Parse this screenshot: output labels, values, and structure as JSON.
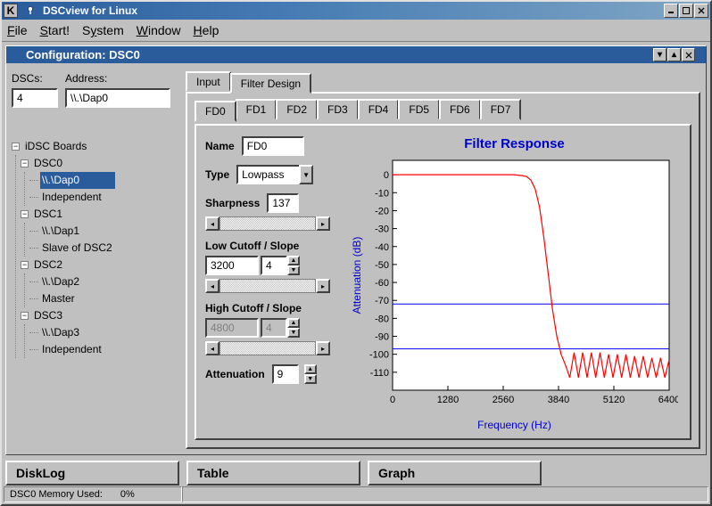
{
  "window": {
    "app_icon": "K",
    "title": "DSCview for Linux"
  },
  "menubar": [
    "File",
    "Start!",
    "System",
    "Window",
    "Help"
  ],
  "sub_window": {
    "title": "Configuration: DSC0"
  },
  "left": {
    "dscs_label": "DSCs:",
    "address_label": "Address:",
    "dscs_value": "4",
    "address_value": "\\\\.\\Dap0",
    "tree_root": "iDSC Boards",
    "tree": [
      {
        "board": "DSC0",
        "children": [
          "\\\\.\\Dap0",
          "Independent"
        ],
        "sel": 0
      },
      {
        "board": "DSC1",
        "children": [
          "\\\\.\\Dap1",
          "Slave of DSC2"
        ]
      },
      {
        "board": "DSC2",
        "children": [
          "\\\\.\\Dap2",
          "Master"
        ]
      },
      {
        "board": "DSC3",
        "children": [
          "\\\\.\\Dap3",
          "Independent"
        ]
      }
    ]
  },
  "tabs": {
    "input": "Input",
    "filter_design": "Filter Design"
  },
  "fd_tabs": [
    "FD0",
    "FD1",
    "FD2",
    "FD3",
    "FD4",
    "FD5",
    "FD6",
    "FD7"
  ],
  "params": {
    "name_label": "Name",
    "name_value": "FD0",
    "type_label": "Type",
    "type_value": "Lowpass",
    "sharpness_label": "Sharpness",
    "sharpness_value": "137",
    "low_label": "Low Cutoff / Slope",
    "low_cutoff": "3200",
    "low_slope": "4",
    "high_label": "High Cutoff / Slope",
    "high_cutoff": "4800",
    "high_slope": "4",
    "atten_label": "Attenuation",
    "atten_value": "9"
  },
  "chart": {
    "title": "Filter Response",
    "xlabel": "Frequency (Hz)",
    "ylabel": "Attenuation (dB)"
  },
  "chart_data": {
    "type": "line",
    "title": "Filter Response",
    "xlabel": "Frequency (Hz)",
    "ylabel": "Attenuation (dB)",
    "xlim": [
      0,
      6400
    ],
    "ylim": [
      -120,
      8
    ],
    "xticks": [
      0,
      1280,
      2560,
      3840,
      5120,
      6400
    ],
    "yticks": [
      0,
      -10,
      -20,
      -30,
      -40,
      -50,
      -60,
      -70,
      -80,
      -90,
      -100,
      -110
    ],
    "hlines": [
      -72,
      -97
    ],
    "series": [
      {
        "name": "response",
        "color": "#ff0000",
        "x": [
          0,
          400,
          800,
          1200,
          1600,
          2000,
          2400,
          2800,
          3000,
          3100,
          3200,
          3300,
          3400,
          3500,
          3600,
          3700,
          3800,
          3900,
          4000,
          4100,
          4200,
          4300,
          4400,
          4500,
          4600,
          4700,
          4800,
          4900,
          5000,
          5100,
          5200,
          5300,
          5400,
          5500,
          5600,
          5700,
          5800,
          5900,
          6000,
          6100,
          6200,
          6300,
          6400
        ],
        "y": [
          0,
          0,
          0,
          0,
          0,
          0,
          0,
          0,
          -0.5,
          -1,
          -3,
          -8,
          -18,
          -35,
          -55,
          -75,
          -90,
          -100,
          -106,
          -113,
          -99,
          -113,
          -99,
          -113,
          -99,
          -113,
          -99,
          -113,
          -100,
          -113,
          -100,
          -113,
          -100,
          -113,
          -101,
          -113,
          -101,
          -113,
          -102,
          -113,
          -102,
          -113,
          -103
        ]
      }
    ]
  },
  "bottom_tabs": [
    "DiskLog",
    "Table",
    "Graph"
  ],
  "status": {
    "mem": "DSC0 Memory Used:",
    "pct": "0%"
  }
}
